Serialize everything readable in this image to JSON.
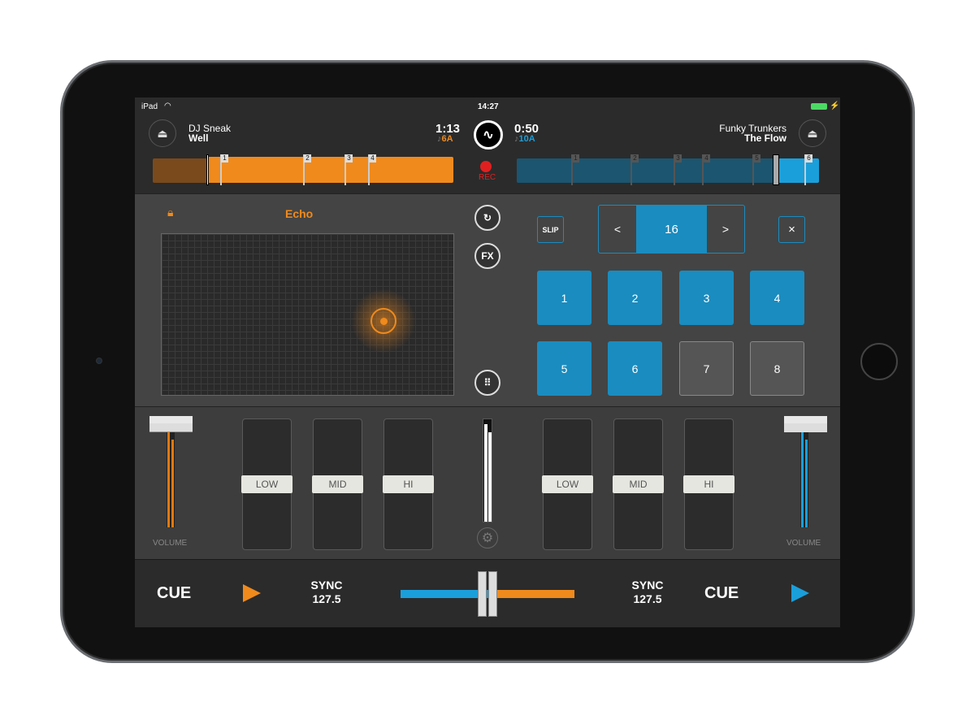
{
  "status": {
    "device": "iPad",
    "time": "14:27",
    "battery_color": "#4cd964"
  },
  "deck_a": {
    "artist": "DJ Sneak",
    "title": "Well",
    "time": "1:13",
    "key": "6A",
    "color": "#f08a1c",
    "cues": [
      "1",
      "2",
      "3",
      "4"
    ]
  },
  "deck_b": {
    "artist": "Funky Trunkers",
    "title": "The Flow",
    "time": "0:50",
    "key": "10A",
    "color": "#1a9fdb",
    "cues": [
      "1",
      "2",
      "3",
      "4",
      "5",
      "6"
    ]
  },
  "rec": {
    "label": "REC",
    "color": "#e02020"
  },
  "fx": {
    "name": "Echo",
    "locked": true,
    "icons": [
      "loop-icon",
      "fx-icon",
      "grid-icon"
    ],
    "fx_label": "FX"
  },
  "loop": {
    "slip": "SLIP",
    "value": "16",
    "prev": "<",
    "next": ">",
    "close": "×"
  },
  "pads": [
    {
      "n": "1",
      "on": true
    },
    {
      "n": "2",
      "on": true
    },
    {
      "n": "3",
      "on": true
    },
    {
      "n": "4",
      "on": true
    },
    {
      "n": "5",
      "on": true
    },
    {
      "n": "6",
      "on": true
    },
    {
      "n": "7",
      "on": false
    },
    {
      "n": "8",
      "on": false
    }
  ],
  "mixer": {
    "volume_label": "VOLUME",
    "eq": [
      "LOW",
      "MID",
      "HI"
    ]
  },
  "transport": {
    "cue": "CUE",
    "sync": "SYNC",
    "bpm_a": "127.5",
    "bpm_b": "127.5"
  }
}
